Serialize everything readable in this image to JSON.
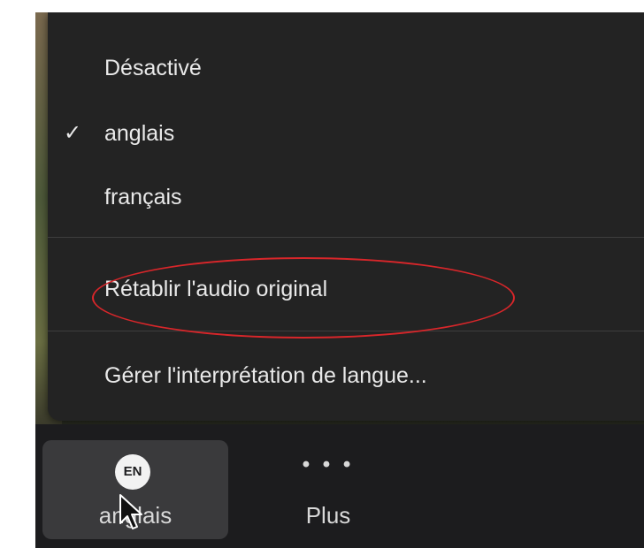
{
  "menu": {
    "items": [
      {
        "label": "Désactivé",
        "checked": false
      },
      {
        "label": "anglais",
        "checked": true
      },
      {
        "label": "français",
        "checked": false
      },
      {
        "label": "Rétablir l'audio original",
        "checked": false
      },
      {
        "label": "Gérer l'interprétation de langue...",
        "checked": false
      }
    ],
    "check_glyph": "✓",
    "highlight_color": "#d9262a"
  },
  "toolbar": {
    "language_badge": "EN",
    "language_label": "anglais",
    "more_icon": "• • •",
    "more_label": "Plus"
  }
}
